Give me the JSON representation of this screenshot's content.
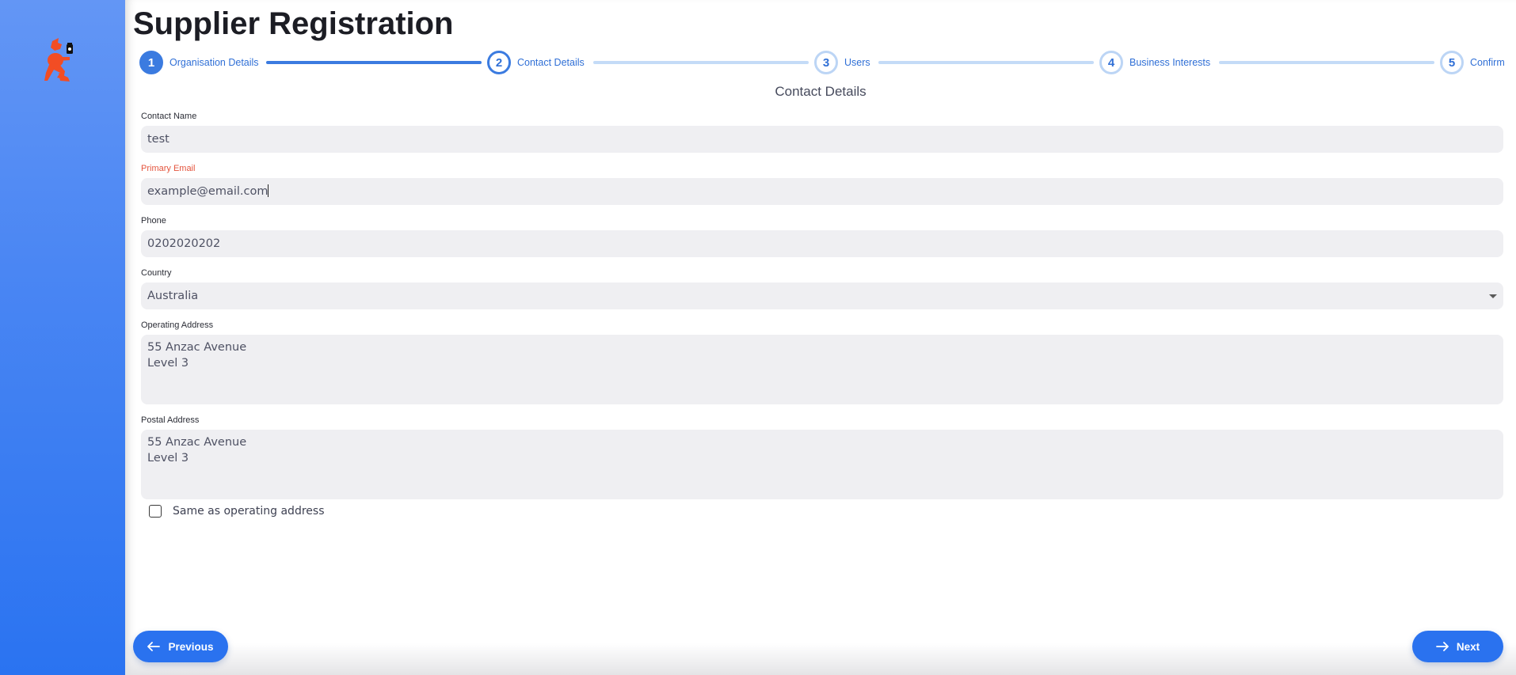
{
  "page": {
    "title": "Supplier Registration",
    "section_title": "Contact Details"
  },
  "stepper": {
    "steps": [
      {
        "number": "1",
        "label": "Organisation Details",
        "state": "done"
      },
      {
        "number": "2",
        "label": "Contact Details",
        "state": "current"
      },
      {
        "number": "3",
        "label": "Users",
        "state": "upcoming"
      },
      {
        "number": "4",
        "label": "Business Interests",
        "state": "upcoming"
      },
      {
        "number": "5",
        "label": "Confirm",
        "state": "upcoming"
      }
    ]
  },
  "form": {
    "contact_name": {
      "label": "Contact Name",
      "value": "test"
    },
    "primary_email": {
      "label": "Primary Email",
      "value": "example@email.com",
      "state": "error"
    },
    "phone": {
      "label": "Phone",
      "value": "0202020202"
    },
    "country": {
      "label": "Country",
      "value": "Australia"
    },
    "operating_address": {
      "label": "Operating Address",
      "value": "55 Anzac Avenue\nLevel 3"
    },
    "postal_address": {
      "label": "Postal Address",
      "value": "55 Anzac Avenue\nLevel 3"
    },
    "same_as_operating": {
      "label": "Same as operating address",
      "checked": false
    }
  },
  "actions": {
    "previous_label": "Previous",
    "next_label": "Next"
  },
  "colors": {
    "primary": "#2a72ef",
    "step_active": "#3b7be0",
    "step_inactive": "#c4dbf7",
    "error": "#e4543d",
    "input_bg": "#efeff2"
  }
}
